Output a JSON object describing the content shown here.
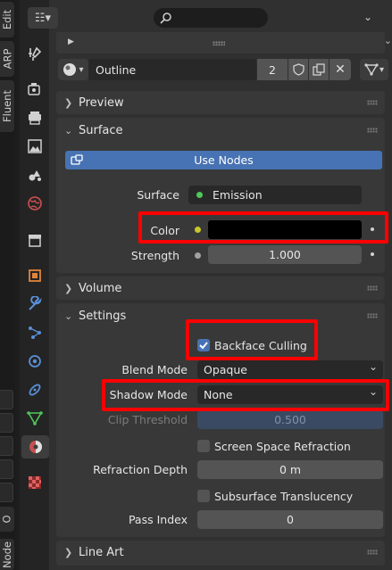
{
  "side_tabs": [
    "Edit",
    "ARP",
    "Fluent",
    "O",
    "Node"
  ],
  "header": {
    "search_placeholder": ""
  },
  "material": {
    "name": "Outline",
    "users": "2"
  },
  "panels": {
    "preview": "Preview",
    "surface": "Surface",
    "volume": "Volume",
    "settings": "Settings",
    "line_art": "Line Art"
  },
  "surface": {
    "use_nodes": "Use Nodes",
    "surface_label": "Surface",
    "surface_value": "Emission",
    "color_label": "Color",
    "strength_label": "Strength",
    "strength_value": "1.000"
  },
  "settings": {
    "backface_culling": "Backface Culling",
    "blend_mode_label": "Blend Mode",
    "blend_mode_value": "Opaque",
    "shadow_mode_label": "Shadow Mode",
    "shadow_mode_value": "None",
    "clip_threshold_label": "Clip Threshold",
    "clip_threshold_value": "0.500",
    "screen_space_refraction": "Screen Space Refraction",
    "refraction_depth_label": "Refraction Depth",
    "refraction_depth_value": "0 m",
    "subsurface_translucency": "Subsurface Translucency",
    "pass_index_label": "Pass Index",
    "pass_index_value": "0"
  },
  "state": {
    "backface_culling": true,
    "screen_space_refraction": false,
    "subsurface_translucency": false
  },
  "colors": {
    "accent_blue": "#4772b3",
    "highlight_red": "#ff0000",
    "socket_green": "#4ec75a",
    "socket_yellow": "#c7c729",
    "socket_gray": "#a1a1a1",
    "color_swatch": "#000000"
  },
  "icons": [
    "editor-type-icon",
    "search-icon",
    "pin-icon",
    "material-sphere-icon",
    "fake-user-shield-icon",
    "duplicate-icon",
    "unlink-x-icon",
    "node-tree-icon",
    "tool-icon",
    "render-icon",
    "output-icon",
    "view-layer-icon",
    "scene-icon",
    "world-icon",
    "collection-icon",
    "object-icon",
    "modifier-icon",
    "particles-icon",
    "physics-icon",
    "constraints-icon",
    "data-icon",
    "material-icon",
    "texture-icon"
  ]
}
